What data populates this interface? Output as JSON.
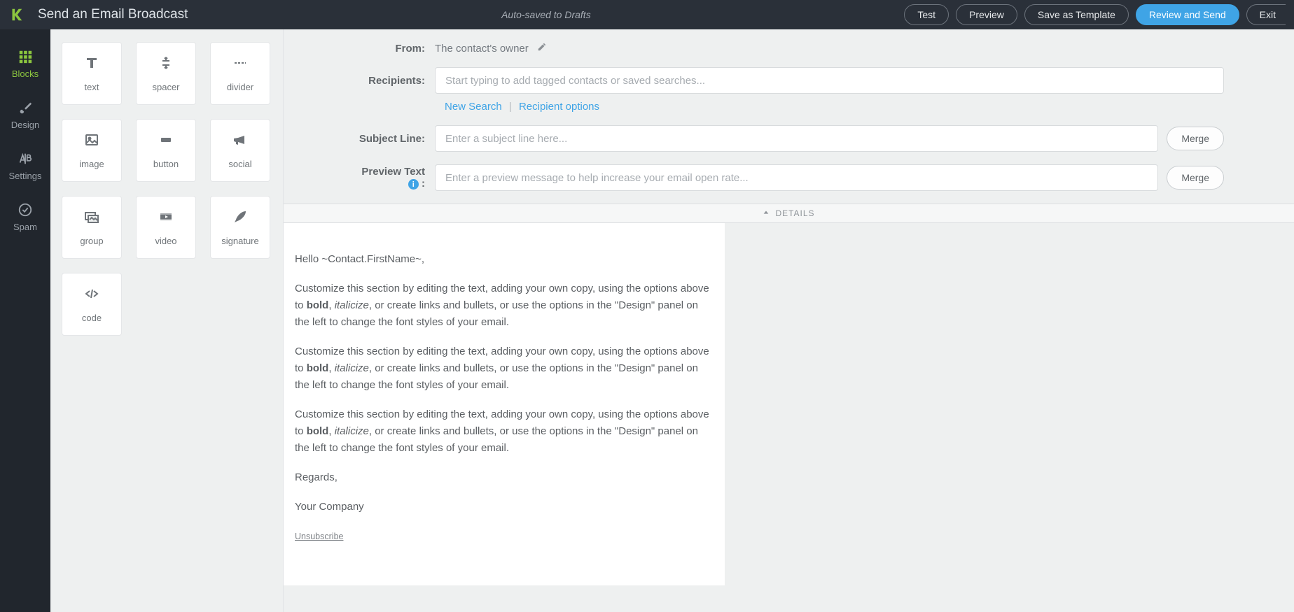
{
  "header": {
    "title": "Send an Email Broadcast",
    "autosave": "Auto-saved to Drafts",
    "actions": {
      "test": "Test",
      "preview": "Preview",
      "save_template": "Save as Template",
      "review_send": "Review and Send",
      "exit": "Exit"
    }
  },
  "rail": {
    "blocks": "Blocks",
    "design": "Design",
    "settings": "Settings",
    "spam": "Spam"
  },
  "blocks": {
    "text": "text",
    "spacer": "spacer",
    "divider": "divider",
    "image": "image",
    "button": "button",
    "social": "social",
    "group": "group",
    "video": "video",
    "signature": "signature",
    "code": "code"
  },
  "fields": {
    "from_label": "From:",
    "from_value": "The contact's owner",
    "recipients_label": "Recipients:",
    "recipients_placeholder": "Start typing to add tagged contacts or saved searches...",
    "new_search": "New Search",
    "recipient_options": "Recipient options",
    "subject_label": "Subject Line:",
    "subject_placeholder": "Enter a subject line here...",
    "preview_label": "Preview Text",
    "preview_placeholder": "Enter a preview message to help increase your email open rate...",
    "merge": "Merge",
    "details": "DETAILS"
  },
  "body": {
    "greeting": "Hello ~Contact.FirstName~,",
    "para_lead": "Customize this section by editing the text, adding your own copy, using the options above to ",
    "bold": "bold",
    "comma": ", ",
    "italic": "italicize",
    "para_tail": ", or create links and bullets, or use the options in the \"Design\" panel on the left to change the font styles of your email.",
    "regards": "Regards,",
    "company": "Your Company",
    "unsubscribe": "Unsubscribe"
  }
}
